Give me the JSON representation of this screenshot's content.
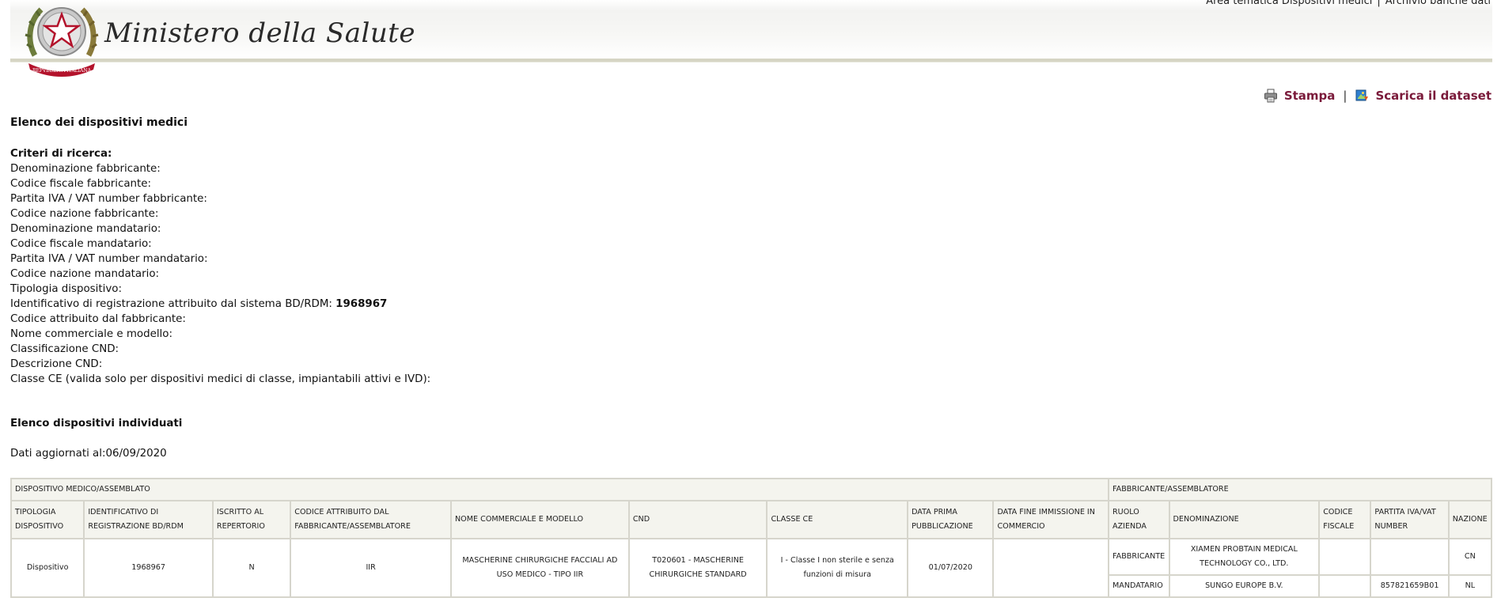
{
  "header": {
    "links": [
      "Area tematica Dispositivi medici",
      "Archivio banche dati"
    ],
    "separator": "|",
    "brand": "Ministero della Salute",
    "emblem_text": "REPVBBLICA ITALIANA"
  },
  "tools": {
    "print_label": "Stampa",
    "separator": "|",
    "download_label": "Scarica il dataset"
  },
  "page_title": "Elenco dei dispositivi medici",
  "criteria": {
    "title": "Criteri di ricerca:",
    "fields": [
      {
        "label": "Denominazione fabbricante:",
        "value": ""
      },
      {
        "label": "Codice fiscale fabbricante:",
        "value": ""
      },
      {
        "label": "Partita IVA / VAT number fabbricante:",
        "value": ""
      },
      {
        "label": "Codice nazione fabbricante:",
        "value": ""
      },
      {
        "label": "Denominazione mandatario:",
        "value": ""
      },
      {
        "label": "Codice fiscale mandatario:",
        "value": ""
      },
      {
        "label": "Partita IVA / VAT number mandatario:",
        "value": ""
      },
      {
        "label": "Codice nazione mandatario:",
        "value": ""
      },
      {
        "label": "Tipologia dispositivo:",
        "value": ""
      },
      {
        "label": "Identificativo di registrazione attribuito dal sistema BD/RDM:",
        "value": "1968967"
      },
      {
        "label": "Codice attribuito dal fabbricante:",
        "value": ""
      },
      {
        "label": "Nome commerciale e modello:",
        "value": ""
      },
      {
        "label": "Classificazione CND:",
        "value": ""
      },
      {
        "label": "Descrizione CND:",
        "value": ""
      },
      {
        "label": "Classe CE (valida solo per dispositivi medici di classe, impiantabili attivi e IVD):",
        "value": ""
      }
    ]
  },
  "results_title": "Elenco dispositivi individuati",
  "updated": "Dati aggiornati al:06/09/2020",
  "table": {
    "group_device": "DISPOSITIVO MEDICO/ASSEMBLATO",
    "group_maker": "FABBRICANTE/ASSEMBLATORE",
    "columns": [
      "TIPOLOGIA DISPOSITIVO",
      "IDENTIFICATIVO DI REGISTRAZIONE BD/RDM",
      "ISCRITTO AL REPERTORIO",
      "CODICE ATTRIBUITO DAL FABBRICANTE/ASSEMBLATORE",
      "NOME COMMERCIALE E MODELLO",
      "CND",
      "CLASSE CE",
      "DATA PRIMA PUBBLICAZIONE",
      "DATA FINE IMMISSIONE IN COMMERCIO",
      "RUOLO AZIENDA",
      "DENOMINAZIONE",
      "CODICE FISCALE",
      "PARTITA IVA/VAT NUMBER",
      "NAZIONE"
    ],
    "device": {
      "tipologia": "Dispositivo",
      "identificativo": "1968967",
      "iscritto": "N",
      "codice": "IIR",
      "nome": "MASCHERINE CHIRURGICHE FACCIALI AD USO MEDICO - TIPO IIR",
      "cnd": "T020601 - MASCHERINE CHIRURGICHE STANDARD",
      "classe": "I - Classe I non sterile e senza funzioni di misura",
      "data_prima": "01/07/2020",
      "data_fine": ""
    },
    "companies": [
      {
        "ruolo": "FABBRICANTE",
        "denominazione": "XIAMEN PROBTAIN MEDICAL TECHNOLOGY CO., LTD.",
        "codice_fiscale": "",
        "partita_iva": "",
        "nazione": "CN"
      },
      {
        "ruolo": "MANDATARIO",
        "denominazione": "SUNGO EUROPE B.V.",
        "codice_fiscale": "",
        "partita_iva": "857821659B01",
        "nazione": "NL"
      }
    ]
  }
}
